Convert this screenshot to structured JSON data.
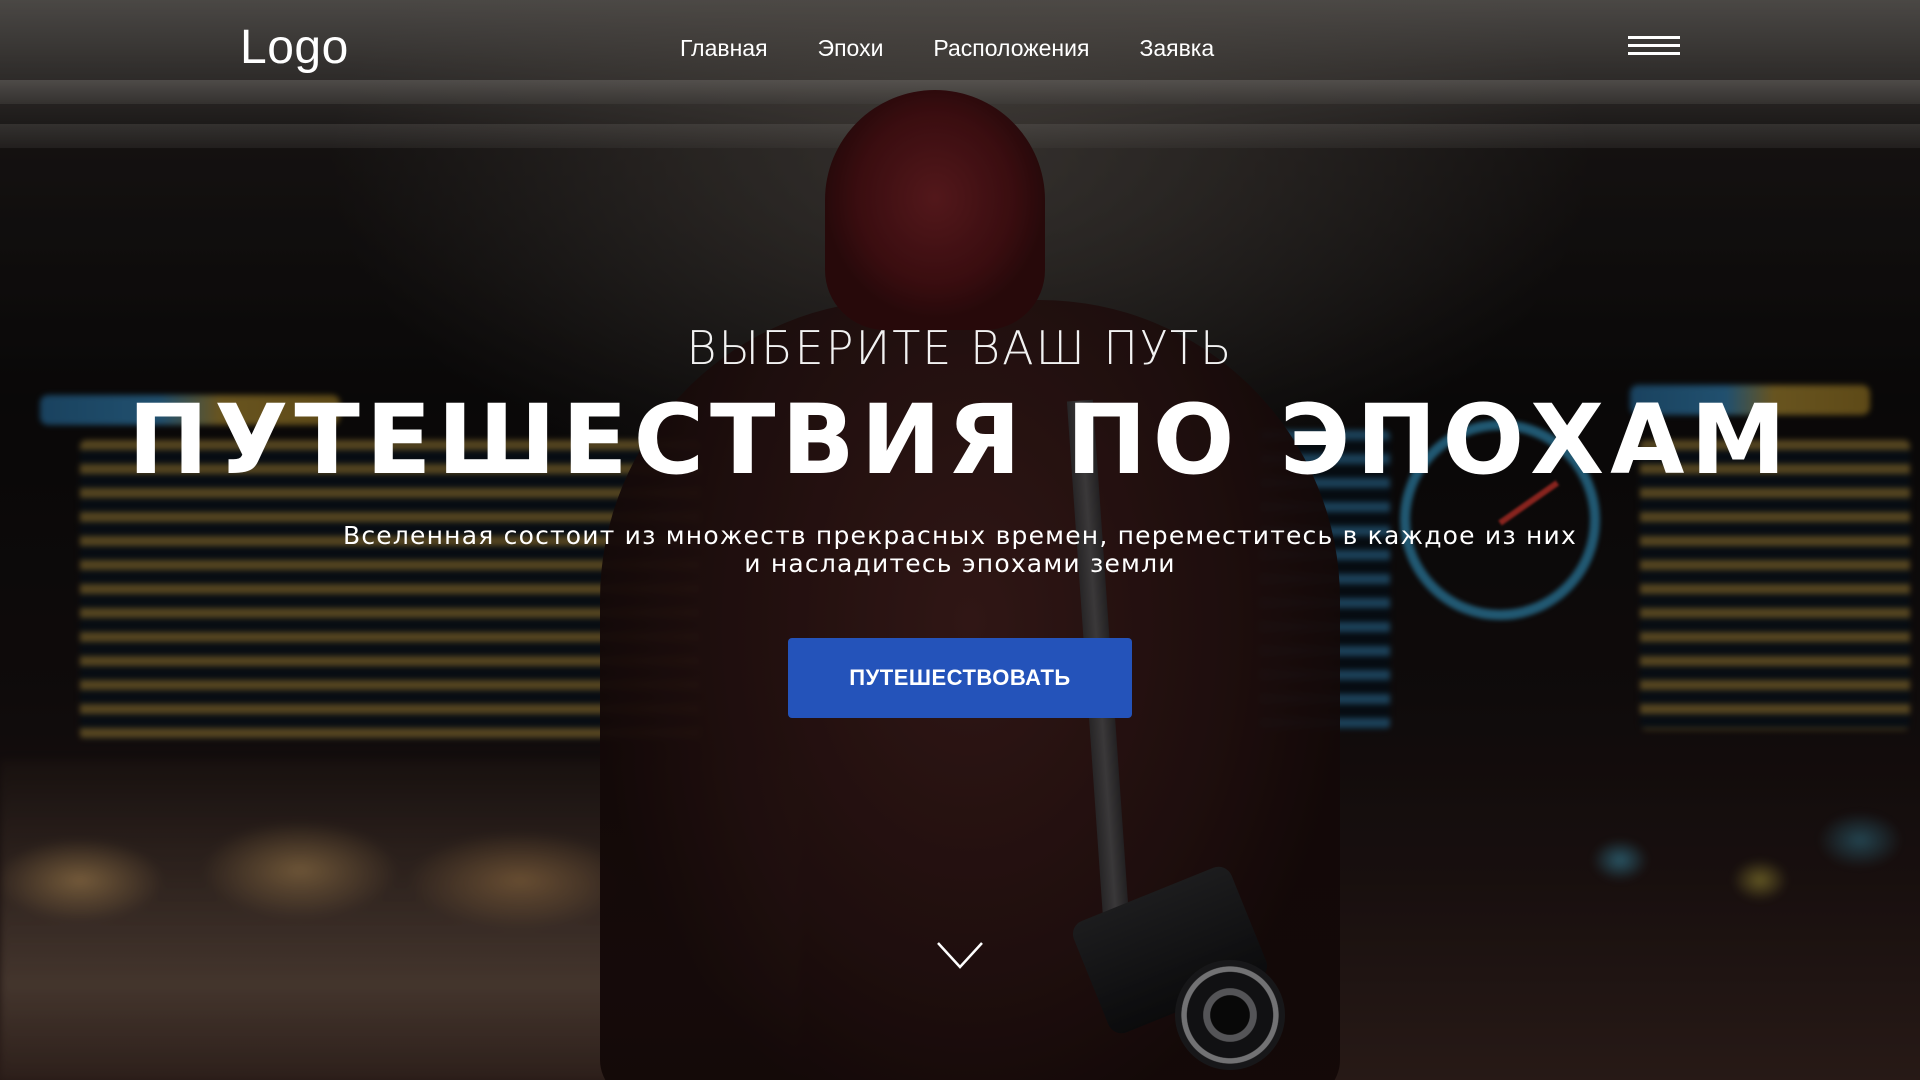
{
  "header": {
    "logo_text": "Logo",
    "nav": {
      "home": "Главная",
      "epochs": "Эпохи",
      "locations": "Расположения",
      "request": "Заявка"
    },
    "menu_icon": "hamburger-menu-icon"
  },
  "hero": {
    "eyebrow": "ВЫБЕРИТЕ ВАШ ПУТЬ",
    "title": "ПУТЕШЕСТВИЯ ПО ЭПОХАМ",
    "subtitle_line1": "Вселенная состоит из множеств прекрасных времен, переместитесь  в каждое из них",
    "subtitle_line2": "и насладитесь эпохами земли",
    "cta_label": "ПУТЕШЕСТВОВАТЬ",
    "scroll_icon": "chevron-down-icon"
  },
  "colors": {
    "accent": "#2453ba",
    "text": "#ffffff"
  }
}
